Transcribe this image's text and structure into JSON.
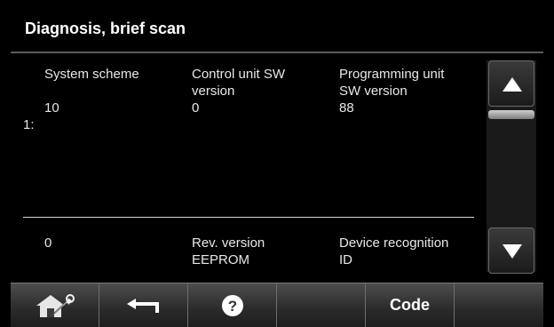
{
  "header": {
    "title": "Diagnosis, brief scan"
  },
  "rows": [
    {
      "marker": "1:",
      "cells": [
        {
          "label": "System scheme",
          "value": "10"
        },
        {
          "label": "Control unit SW\nversion",
          "value": "0"
        },
        {
          "label": "Programming unit\nSW version",
          "value": "88"
        }
      ]
    },
    {
      "cells": [
        {
          "label": "0"
        },
        {
          "label": "Rev. version\nEEPROM"
        },
        {
          "label": "Device recognition\nID"
        }
      ]
    }
  ],
  "scroll": {
    "up_icon": "arrow-up-icon",
    "down_icon": "arrow-down-icon"
  },
  "toolbar": {
    "home_icon": "house-wrench-icon",
    "back_icon": "back-arrow-icon",
    "help_icon": "question-icon",
    "code_label": "Code"
  },
  "colors": {
    "background": "#000000",
    "text": "#ffffff",
    "bar": "#2a2a2a"
  }
}
